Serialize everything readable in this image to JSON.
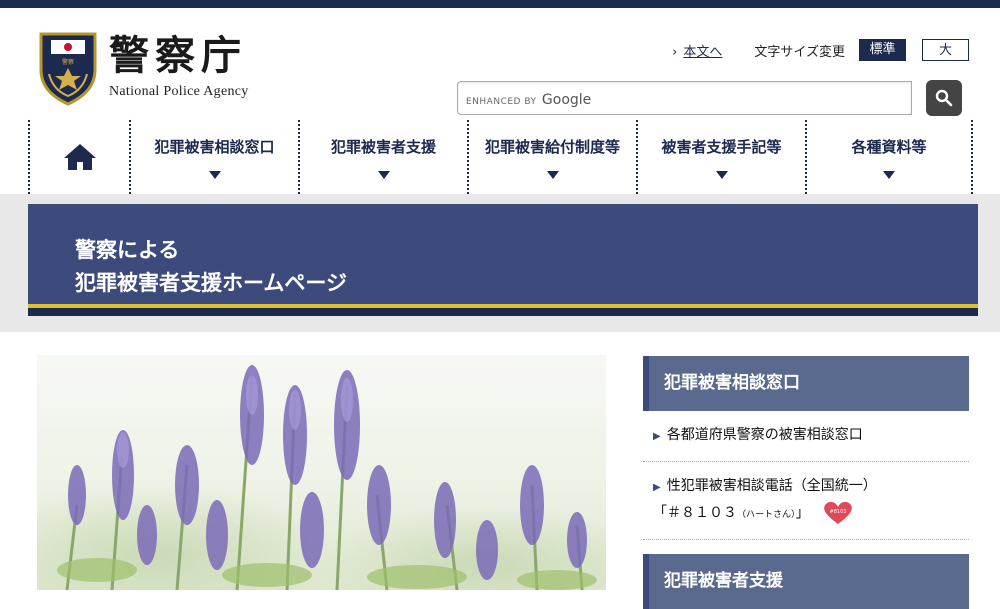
{
  "header": {
    "site_title": "警察庁",
    "site_subtitle": "National Police Agency",
    "emblem_icon": "police-emblem-icon",
    "skip_link": "本文へ",
    "font_size_label": "文字サイズ変更",
    "font_size_options": [
      "標準",
      "大"
    ],
    "search": {
      "placeholder_prefix": "ENHANCED BY",
      "placeholder_brand": "Google"
    }
  },
  "nav": {
    "home_icon": "home-icon",
    "items": [
      "犯罪被害相談窓口",
      "犯罪被害者支援",
      "犯罪被害給付制度等",
      "被害者支援手記等",
      "各種資料等"
    ]
  },
  "hero": {
    "line1": "警察による",
    "line2": "犯罪被害者支援ホームページ"
  },
  "sidebar": {
    "section1_title": "犯罪被害相談窓口",
    "link1": "各都道府県警察の被害相談窓口",
    "link2_line1": "性犯罪被害相談電話（全国統一）",
    "link2_line2_open": "「＃８１０３",
    "link2_line2_small": "（ハートさん）",
    "link2_line2_close": "」",
    "heart_badge_text": "#8103",
    "section2_title": "犯罪被害者支援"
  },
  "colors": {
    "brand": "#1d2a4f",
    "hero": "#3d4b7c",
    "accent_line": "#d8c22e",
    "sidebar_header": "#5a6a8f"
  }
}
